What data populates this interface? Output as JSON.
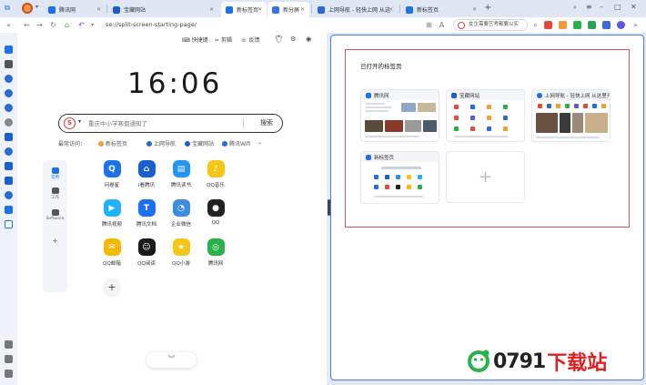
{
  "tabs": [
    {
      "label": "腾讯网",
      "color": "#1a73e8",
      "active": false
    },
    {
      "label": "宝藏网站",
      "color": "#1a5fd0",
      "active": false
    },
    {
      "label": "新标签页",
      "color": "#1a73e8",
      "active": true
    },
    {
      "label": "新分屏",
      "color": "#3a73e8",
      "active": false
    },
    {
      "label": "上网导航 - 轻快上网 从这里开始",
      "color": "#2a6ad8",
      "active": false
    },
    {
      "label": "新标签页",
      "color": "#1a73e8",
      "active": false
    }
  ],
  "nav": {
    "url": "se://split-screen-starting-page/",
    "search_text": "女生需要艺考都要以实"
  },
  "newtab": {
    "top_items": {
      "shortcut": "快捷键",
      "clip": "剪辑",
      "feedback": "反馈"
    },
    "clock": "16:06",
    "search": {
      "placeholder": "重庆中小学寒假通知了",
      "button": "搜索"
    },
    "quicklinks": {
      "label": "最常访问：",
      "items": [
        "新标签页",
        "上网导航",
        "宝藏网站",
        "腾讯Wifi"
      ]
    },
    "categories": [
      "常用",
      "工作",
      "Software"
    ],
    "apps": [
      {
        "label": "问卷星",
        "color": "#1a73e8",
        "glyph": "Q"
      },
      {
        "label": "i看腾讯",
        "color": "#1a5fd0",
        "glyph": "⌂"
      },
      {
        "label": "腾讯读书",
        "color": "#2196f3",
        "glyph": "▤"
      },
      {
        "label": "QQ音乐",
        "color": "#f5c518",
        "glyph": "♪"
      },
      {
        "label": "腾讯视频",
        "color": "#20b2ff",
        "glyph": "▶"
      },
      {
        "label": "腾讯文档",
        "color": "#1b6ff3",
        "glyph": "T"
      },
      {
        "label": "企业微信",
        "color": "#3a8de0",
        "glyph": "◔"
      },
      {
        "label": "QQ",
        "color": "#222222",
        "glyph": "●"
      },
      {
        "label": "QQ邮箱",
        "color": "#f6b800",
        "glyph": "✉"
      },
      {
        "label": "QQ阅读",
        "color": "#1a1a1a",
        "glyph": "☺"
      },
      {
        "label": "QQ小游",
        "color": "#f5c518",
        "glyph": "★"
      },
      {
        "label": "腾讯网",
        "color": "#2bb14a",
        "glyph": "◎"
      }
    ]
  },
  "rightpane": {
    "title": "已打开的标签页",
    "cards": [
      {
        "label": "腾讯网",
        "color": "#1a73e8"
      },
      {
        "label": "宝藏网站",
        "color": "#1a5fd0"
      },
      {
        "label": "上网导航 - 轻快上网 从这里开始",
        "color": "#2a6ad8"
      },
      {
        "label": "新标签页",
        "color": "#1a73e8"
      }
    ]
  },
  "watermark": {
    "digits": "0791",
    "text": "下载站"
  },
  "colors": {
    "accent": "#1a73e8",
    "highlight_border": "#e05353",
    "pane_border": "#4a7ee0"
  }
}
